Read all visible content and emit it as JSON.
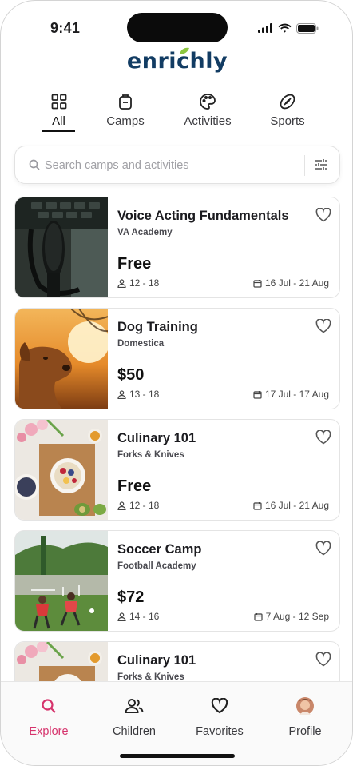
{
  "status_bar": {
    "time": "9:41"
  },
  "app": {
    "logo_text": "enrichly"
  },
  "tabs": [
    {
      "label": "All",
      "icon": "grid-icon",
      "active": true
    },
    {
      "label": "Camps",
      "icon": "backpack-icon"
    },
    {
      "label": "Activities",
      "icon": "palette-icon"
    },
    {
      "label": "Sports",
      "icon": "football-icon"
    }
  ],
  "search": {
    "placeholder": "Search camps and activities",
    "value": ""
  },
  "listings": [
    {
      "title": "Voice Acting Fundamentals",
      "org": "VA Academy",
      "price": "Free",
      "ages": "12 - 18",
      "dates": "16 Jul - 21 Aug",
      "image": "microphone-photo"
    },
    {
      "title": "Dog Training",
      "org": "Domestica",
      "price": "$50",
      "ages": "13 - 18",
      "dates": "17 Jul - 17 Aug",
      "image": "dog-sunset-photo"
    },
    {
      "title": "Culinary 101",
      "org": "Forks & Knives",
      "price": "Free",
      "ages": "12 - 18",
      "dates": "16 Jul - 21 Aug",
      "image": "food-bowls-photo"
    },
    {
      "title": "Soccer Camp",
      "org": "Football Academy",
      "price": "$72",
      "ages": "14 - 16",
      "dates": "7 Aug - 12 Sep",
      "image": "kids-soccer-photo"
    },
    {
      "title": "Culinary 101",
      "org": "Forks & Knives",
      "price": "",
      "ages": "",
      "dates": "",
      "image": "food-bowls-photo"
    }
  ],
  "bottom_nav": [
    {
      "label": "Explore",
      "icon": "search-icon",
      "active": true
    },
    {
      "label": "Children",
      "icon": "people-icon"
    },
    {
      "label": "Favorites",
      "icon": "heart-icon"
    },
    {
      "label": "Profile",
      "icon": "avatar"
    }
  ],
  "colors": {
    "accent": "#d6336c",
    "brand": "#123c63",
    "leaf": "#8cc63f"
  }
}
